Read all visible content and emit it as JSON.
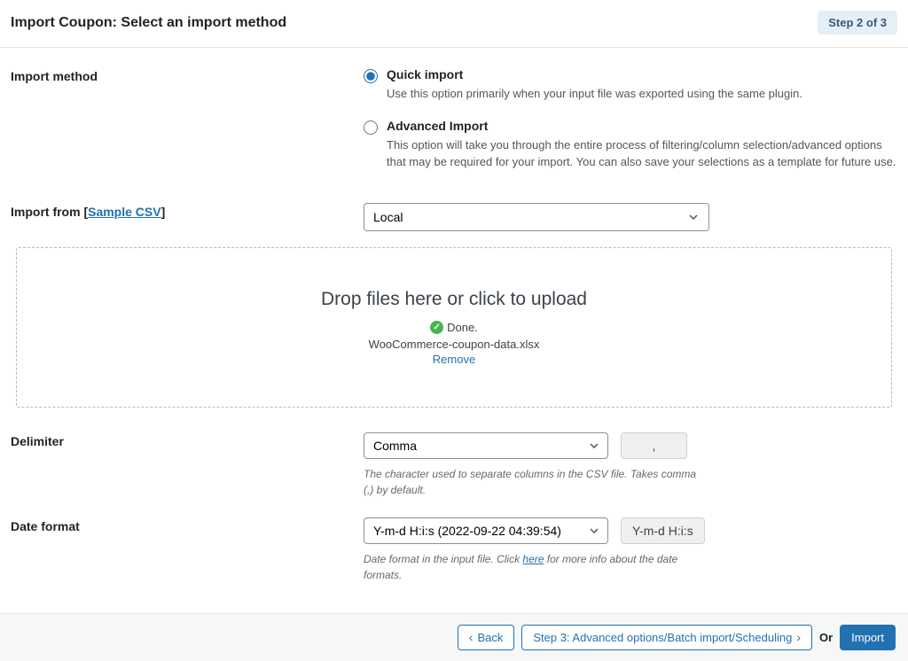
{
  "header": {
    "title": "Import Coupon: Select an import method",
    "step_badge": "Step 2 of 3"
  },
  "import_method": {
    "label": "Import method",
    "quick": {
      "title": "Quick import",
      "desc": "Use this option primarily when your input file was exported using the same plugin."
    },
    "advanced": {
      "title": "Advanced Import",
      "desc": "This option will take you through the entire process of filtering/column selection/advanced options that may be required for your import. You can also save your selections as a template for future use."
    }
  },
  "import_from": {
    "label_prefix": "Import from [",
    "sample_link": "Sample CSV",
    "label_suffix": "]",
    "value": "Local"
  },
  "dropzone": {
    "title": "Drop files here or click to upload",
    "done": "Done.",
    "filename": "WooCommerce-coupon-data.xlsx",
    "remove": "Remove"
  },
  "delimiter": {
    "label": "Delimiter",
    "value": "Comma",
    "symbol": ",",
    "helper": "The character used to separate columns in the CSV file. Takes comma (,) by default."
  },
  "date_format": {
    "label": "Date format",
    "value": "Y-m-d H:i:s (2022-09-22 04:39:54)",
    "display": "Y-m-d H:i:s",
    "helper_prefix": "Date format in the input file. Click ",
    "helper_link": "here",
    "helper_suffix": " for more info about the date formats."
  },
  "footer": {
    "back": "Back",
    "next": "Step 3: Advanced options/Batch import/Scheduling",
    "or": "Or",
    "import": "Import"
  }
}
